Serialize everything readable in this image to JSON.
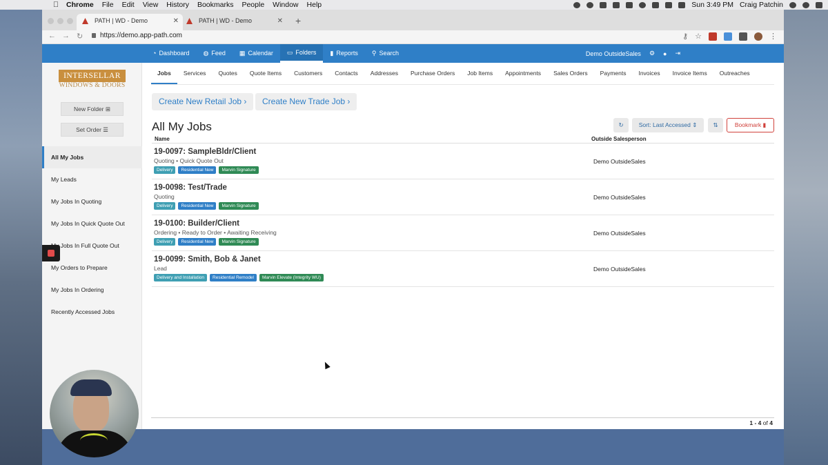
{
  "mac_menu": {
    "app": "Chrome",
    "items": [
      "File",
      "Edit",
      "View",
      "History",
      "Bookmarks",
      "People",
      "Window",
      "Help"
    ],
    "clock": "Sun 3:49 PM",
    "user": "Craig Patchin"
  },
  "browser": {
    "tabs": [
      {
        "title": "PATH | WD - Demo",
        "active": true
      },
      {
        "title": "PATH | WD - Demo",
        "active": false
      }
    ],
    "url": "https://demo.app-path.com"
  },
  "app_nav": {
    "items": [
      {
        "label": "Dashboard",
        "icon": "dashboard-icon"
      },
      {
        "label": "Feed",
        "icon": "globe-icon"
      },
      {
        "label": "Calendar",
        "icon": "calendar-icon"
      },
      {
        "label": "Folders",
        "icon": "folder-icon",
        "active": true
      },
      {
        "label": "Reports",
        "icon": "bar-chart-icon"
      },
      {
        "label": "Search",
        "icon": "search-icon"
      }
    ],
    "user_label": "Demo OutsideSales"
  },
  "sidebar": {
    "logo_line1": "INTERSELLAR",
    "logo_line2": "WINDOWS & DOORS",
    "new_folder": "New Folder",
    "set_order": "Set Order",
    "items": [
      "All My Jobs",
      "My Leads",
      "My Jobs In Quoting",
      "My Jobs In Quick Quote Out",
      "My Jobs In Full Quote Out",
      "My Orders to Prepare",
      "My Jobs In Ordering",
      "Recently Accessed Jobs"
    ],
    "active_index": 0
  },
  "subtabs": [
    "Jobs",
    "Services",
    "Quotes",
    "Quote Items",
    "Customers",
    "Contacts",
    "Addresses",
    "Purchase Orders",
    "Job Items",
    "Appointments",
    "Sales Orders",
    "Payments",
    "Invoices",
    "Invoice Items",
    "Outreaches"
  ],
  "actions": {
    "create_retail": "Create New Retail Job",
    "create_trade": "Create New Trade Job",
    "sort": "Sort: Last Accessed",
    "bookmark": "Bookmark"
  },
  "page_title": "All My Jobs",
  "table": {
    "col_name": "Name",
    "col_sales": "Outside Salesperson",
    "rows": [
      {
        "title": "19-0097: SampleBldr/Client",
        "status": "Quoting • Quick Quote Out",
        "badges": [
          {
            "text": "Delivery",
            "color": "#3f9fb3"
          },
          {
            "text": "Residential New",
            "color": "#2f7fc7"
          },
          {
            "text": "Marvin Signature",
            "color": "#2f8a55"
          }
        ],
        "salesperson": "Demo OutsideSales"
      },
      {
        "title": "19-0098: Test/Trade",
        "status": "Quoting",
        "badges": [
          {
            "text": "Delivery",
            "color": "#3f9fb3"
          },
          {
            "text": "Residential New",
            "color": "#2f7fc7"
          },
          {
            "text": "Marvin Signature",
            "color": "#2f8a55"
          }
        ],
        "salesperson": "Demo OutsideSales"
      },
      {
        "title": "19-0100: Builder/Client",
        "status": "Ordering • Ready to Order • Awaiting Receiving",
        "badges": [
          {
            "text": "Delivery",
            "color": "#3f9fb3"
          },
          {
            "text": "Residential New",
            "color": "#2f7fc7"
          },
          {
            "text": "Marvin Signature",
            "color": "#2f8a55"
          }
        ],
        "salesperson": "Demo OutsideSales"
      },
      {
        "title": "19-0099: Smith, Bob & Janet",
        "status": "Lead",
        "badges": [
          {
            "text": "Delivery and Installation",
            "color": "#3f9fb3"
          },
          {
            "text": "Residential Remodel",
            "color": "#2f7fc7"
          },
          {
            "text": "Marvin Elevate (Integrity WU)",
            "color": "#2f8a55"
          }
        ],
        "salesperson": "Demo OutsideSales"
      }
    ]
  },
  "pager": {
    "range": "1 - 4",
    "of": "of",
    "total": "4"
  }
}
